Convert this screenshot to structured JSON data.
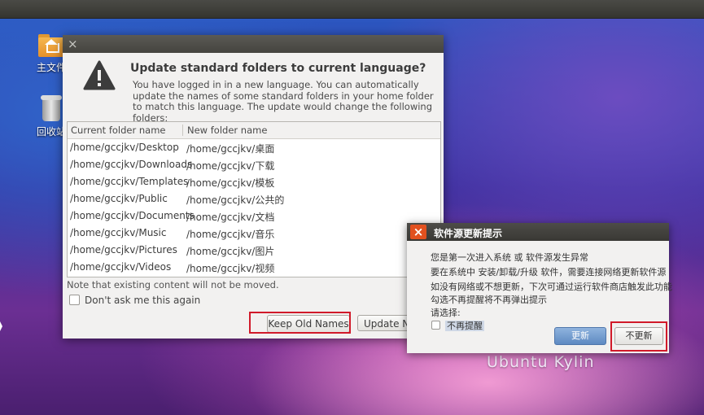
{
  "desktop": {
    "brand": "Ubuntu Kylin",
    "icons": [
      {
        "label": "主文件",
        "icon": "home-folder-icon"
      },
      {
        "label": "回收站",
        "icon": "trash-icon"
      }
    ]
  },
  "folders_dialog": {
    "close_glyph": "×",
    "title": "Update standard folders to current language?",
    "text": "You have logged in in a new language. You can automatically update the names of some standard folders in your home folder to match this language. The update would change the following folders:",
    "columns": [
      "Current folder name",
      "New folder name"
    ],
    "rows": [
      {
        "current": "/home/gccjkv/Desktop",
        "new": "/home/gccjkv/桌面"
      },
      {
        "current": "/home/gccjkv/Downloads",
        "new": "/home/gccjkv/下载"
      },
      {
        "current": "/home/gccjkv/Templates",
        "new": "/home/gccjkv/模板"
      },
      {
        "current": "/home/gccjkv/Public",
        "new": "/home/gccjkv/公共的"
      },
      {
        "current": "/home/gccjkv/Documents",
        "new": "/home/gccjkv/文档"
      },
      {
        "current": "/home/gccjkv/Music",
        "new": "/home/gccjkv/音乐"
      },
      {
        "current": "/home/gccjkv/Pictures",
        "new": "/home/gccjkv/图片"
      },
      {
        "current": "/home/gccjkv/Videos",
        "new": "/home/gccjkv/视频"
      }
    ],
    "note": "Note that existing content will not be moved.",
    "dont_ask_label": "Don't ask me this again",
    "keep_label": "Keep Old Names",
    "update_label": "Update Na"
  },
  "update_dialog": {
    "close_glyph": "×",
    "title": "软件源更新提示",
    "lines": [
      "您是第一次进入系统 或 软件源发生异常",
      "要在系统中 安装/卸载/升级 软件，需要连接网络更新软件源",
      "如没有网络或不想更新，下次可通过运行软件商店触发此功能",
      "勾选不再提醒将不再弹出提示",
      "请选择:"
    ],
    "no_remind_label": "不再提醒",
    "update_label": "更新",
    "no_update_label": "不更新"
  },
  "colors": {
    "highlight": "#d11a2a",
    "close_orange": "#e2511f"
  }
}
